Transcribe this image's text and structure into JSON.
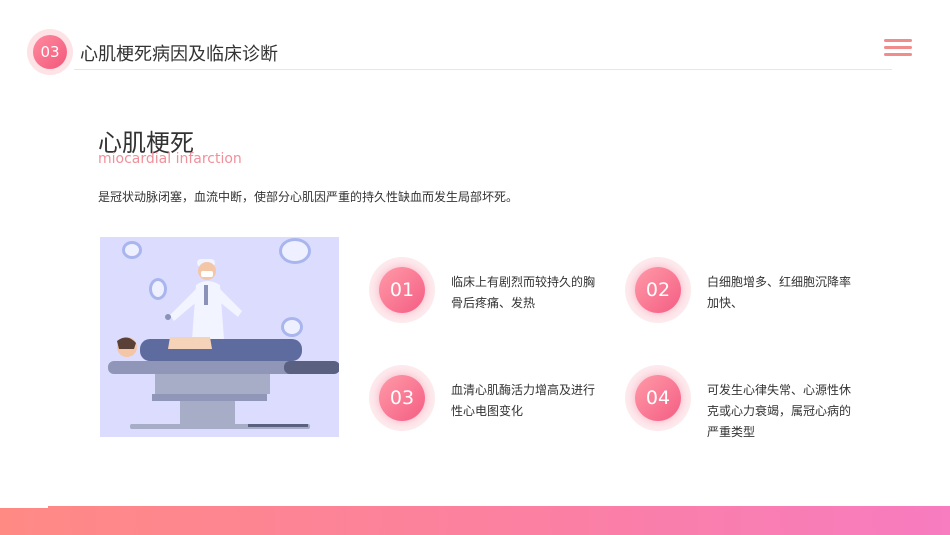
{
  "header": {
    "number": "03",
    "title": "心肌梗死病因及临床诊断"
  },
  "section": {
    "title": "心肌梗死",
    "subtitle": "miocardial infarction",
    "description": "是冠状动脉闭塞，血流中断，使部分心肌因严重的持久性缺血而发生局部坏死。"
  },
  "items": [
    {
      "number": "01",
      "text": "临床上有剧烈而较持久的胸骨后疼痛、发热"
    },
    {
      "number": "02",
      "text": "白细胞增多、红细胞沉降率加快、"
    },
    {
      "number": "03",
      "text": "血清心肌酶活力增高及进行性心电图变化"
    },
    {
      "number": "04",
      "text": "可发生心律失常、心源性休克或心力衰竭，属冠心病的严重类型"
    }
  ],
  "colors": {
    "accent": "#f45d83",
    "subtitle": "#f0909a",
    "menu": "#f28b8b",
    "illustration_bg": "#dcdcff"
  },
  "icons": {
    "menu": "hamburger-menu-icon",
    "illustration": "surgery-illustration"
  }
}
